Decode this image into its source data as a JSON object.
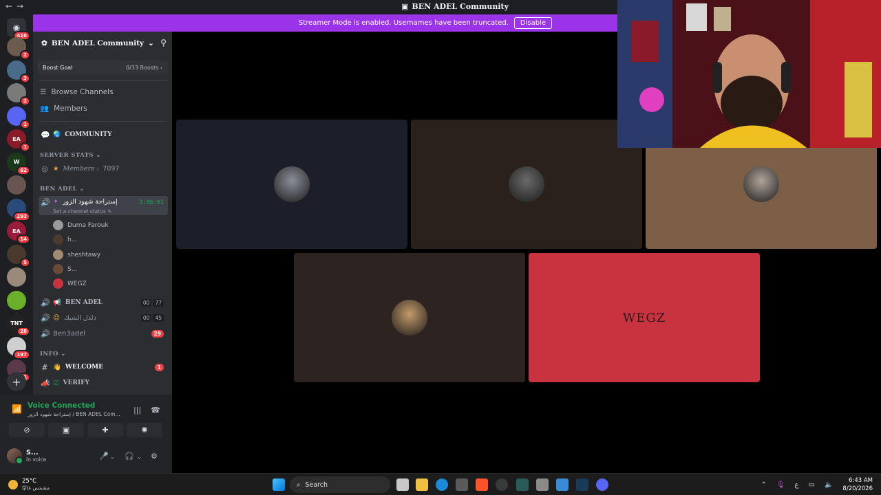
{
  "window": {
    "title": "BEN ADEL Community",
    "back": "←",
    "forward": "→"
  },
  "banner": {
    "text": "Streamer Mode is enabled. Usernames have been truncated.",
    "button": "Disable"
  },
  "rail": {
    "home_badge": "416",
    "servers": [
      {
        "badge": "2",
        "color": "#6b5a4e"
      },
      {
        "badge": "3",
        "color": "#4a6a8a"
      },
      {
        "badge": "2",
        "color": "#7a7a7a"
      },
      {
        "badge": "1",
        "color": "#5865f2"
      },
      {
        "badge": "1",
        "color": "#8a1c2a",
        "text": "EA"
      },
      {
        "badge": "62",
        "color": "#1a3a1a",
        "text": "W"
      },
      {
        "badge": "",
        "color": "#6a5450"
      },
      {
        "badge": "293",
        "color": "#2a4a7a"
      },
      {
        "badge": "14",
        "color": "#9a1c3a",
        "text": "EA"
      },
      {
        "badge": "5",
        "color": "#4a3a2e"
      },
      {
        "badge": "",
        "color": "#9a8a7a"
      },
      {
        "badge": "",
        "color": "#6ab02a"
      },
      {
        "badge": "28",
        "color": "#222",
        "text": "TNT"
      },
      {
        "badge": "197",
        "color": "#cfcfcf"
      },
      {
        "badge": "371",
        "color": "#5a3a4a"
      }
    ],
    "add": "+"
  },
  "sidebar": {
    "server_name": "BEN ADEL Community",
    "boost_label": "Boost Goal",
    "boost_value": "0/33 Boosts",
    "browse": "Browse Channels",
    "members": "Members",
    "community": "COMMUNITY",
    "cat_stats": "SERVER STATS",
    "members_stat_label": "Members :",
    "members_stat_value": "7097",
    "cat_benadel": "BEN ADEL",
    "active_channel": "إستراحة شهود الزور",
    "active_timer": "3:06:01",
    "status_hint": "Set a channel status",
    "voice_users": [
      "Duma Farouk",
      "h...",
      "sheshtawy",
      "S...",
      "WEGZ"
    ],
    "voice2_name": "BEN ADEL",
    "voice2_counts": [
      "00",
      "77"
    ],
    "voice3_name": "دلدل الشيك",
    "voice3_counts": [
      "00",
      "45"
    ],
    "voice4_name": "Ben3adel",
    "voice4_badge": "29",
    "cat_info": "INFO",
    "welcome": "WELCOME",
    "welcome_badge": "1",
    "verify": "VERIFY"
  },
  "voice_panel": {
    "connected": "Voice Connected",
    "location": "إستراحة شهود الزور / BEN ADEL Com...",
    "username": "S...",
    "user_status": "In voice"
  },
  "tiles": [
    {
      "bg": "#1c1f2a",
      "avatar": "#8a8f98"
    },
    {
      "bg": "#2a211d",
      "avatar": "#6a6a6a"
    },
    {
      "bg": "#7d5f48",
      "avatar": "#b0a49a"
    },
    {
      "bg": "#2d2321",
      "avatar": "#c49a6a"
    },
    {
      "bg": "#c9323f",
      "label": "WEGZ"
    }
  ],
  "taskbar": {
    "temp": "25°C",
    "weather": "مشمس غالبًا",
    "search": "Search",
    "lang": "ع",
    "time": "6:43 AM",
    "date": "8/20/2026"
  }
}
